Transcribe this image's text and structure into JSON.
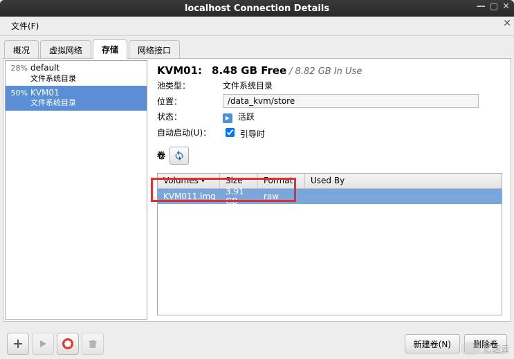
{
  "window": {
    "title": "localhost Connection Details"
  },
  "menu": {
    "file": "文件(F)"
  },
  "tabs": {
    "overview": "概况",
    "virtualnet": "虚拟网络",
    "storage": "存储",
    "netif": "网络接口"
  },
  "pools": [
    {
      "percent": "28%",
      "name": "default",
      "sub": "文件系统目录"
    },
    {
      "percent": "50%",
      "name": "KVM01",
      "sub": "文件系统目录"
    }
  ],
  "detail": {
    "name_label": "KVM01:",
    "free": "8.48 GB Free",
    "inuse": "/ 8.82 GB In Use",
    "pooltype_label": "池类型：",
    "pooltype_value": "文件系统目录",
    "location_label": "位置：",
    "location_value": "/data_kvm/store",
    "state_label": "状态：",
    "state_value": "活跃",
    "autostart_label": "自动启动(U)：",
    "autostart_value": "引导时",
    "volumes_label": "卷"
  },
  "table": {
    "columns": {
      "volumes": "Volumes",
      "size": "Size",
      "format": "Format",
      "usedby": "Used By"
    },
    "rows": [
      {
        "name": "KVM011.img",
        "size": "3.91 GB",
        "format": "raw",
        "usedby": ""
      }
    ]
  },
  "buttons": {
    "new_volume": "新建卷(N)",
    "delete_volume": "删除卷"
  },
  "watermark": "亿速云"
}
